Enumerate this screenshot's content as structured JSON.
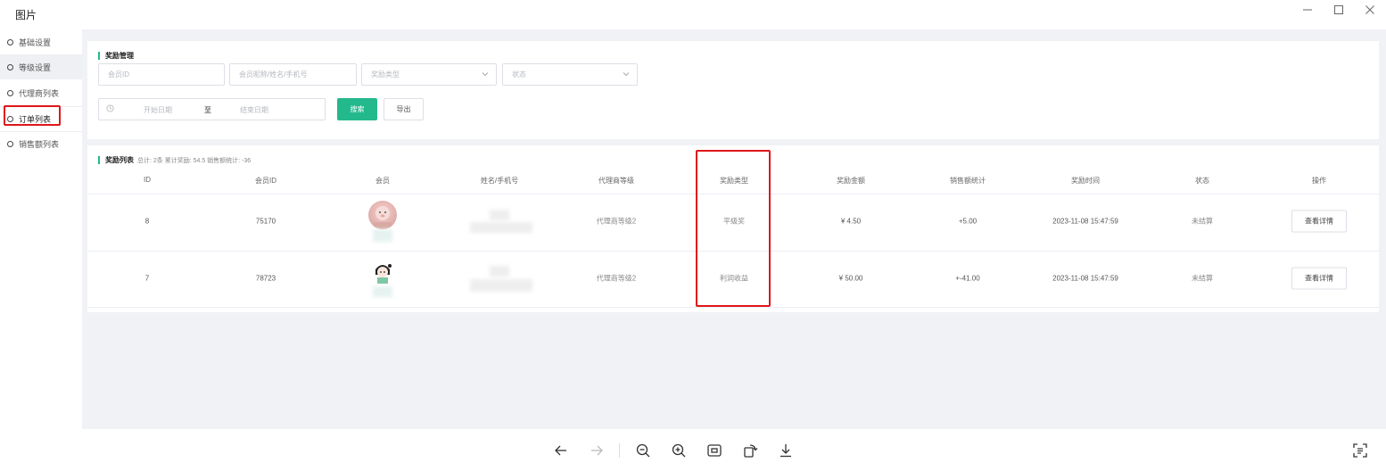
{
  "window": {
    "title": "图片"
  },
  "sidebar": {
    "items": [
      {
        "label": "基础设置"
      },
      {
        "label": "等级设置"
      },
      {
        "label": "代理商列表"
      },
      {
        "label": "订单列表"
      },
      {
        "label": "销售额列表"
      }
    ]
  },
  "filter": {
    "title": "奖励管理",
    "member_id_placeholder": "会员ID",
    "member_name_placeholder": "会员昵称/姓名/手机号",
    "reward_type_placeholder": "奖励类型",
    "status_placeholder": "状态",
    "start_date_placeholder": "开始日期",
    "range_separator": "至",
    "end_date_placeholder": "结束日期",
    "search_label": "搜索",
    "export_label": "导出"
  },
  "list": {
    "title": "奖励列表",
    "summary": "总计: 2条 累计奖励: 54.5 销售额统计: -36",
    "columns": [
      "ID",
      "会员ID",
      "会员",
      "姓名/手机号",
      "代理商等级",
      "奖励类型",
      "奖励金额",
      "销售额统计",
      "奖励时间",
      "状态",
      "操作"
    ],
    "rows": [
      {
        "id": "8",
        "member_id": "75170",
        "level": "代理商等级2",
        "reward_type": "平级奖",
        "amount": "¥ 4.50",
        "sales": "+5.00",
        "time": "2023-11-08 15:47:59",
        "status": "未结算",
        "action": "查看详情"
      },
      {
        "id": "7",
        "member_id": "78723",
        "level": "代理商等级2",
        "reward_type": "利润收益",
        "amount": "¥ 50.00",
        "sales": "+-41.00",
        "time": "2023-11-08 15:47:59",
        "status": "未结算",
        "action": "查看详情"
      }
    ]
  },
  "colors": {
    "accent": "#23b98c",
    "highlight": "#e0161b",
    "background": "#f0f2f5"
  },
  "toolbar": {
    "icons": [
      "arrow-left-icon",
      "arrow-right-icon",
      "zoom-out-icon",
      "zoom-in-icon",
      "fit-screen-icon",
      "rotate-icon",
      "download-icon",
      "ocr-icon"
    ]
  }
}
